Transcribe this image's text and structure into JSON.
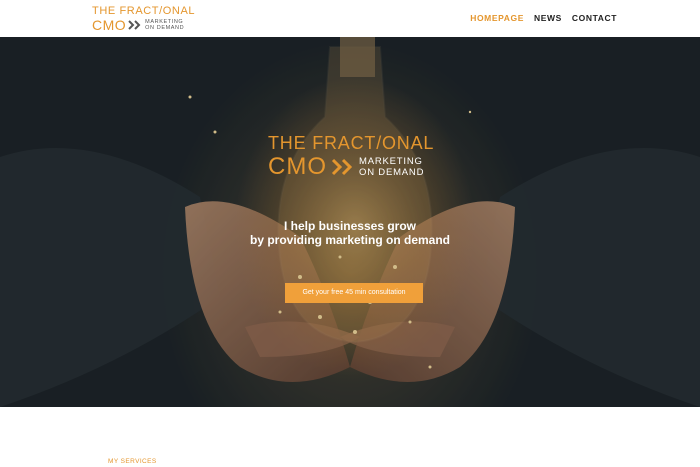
{
  "header": {
    "logo": {
      "line1": "THE FRACT/ONAL",
      "cmo": "CMO",
      "tag_line1": "MARKETING",
      "tag_line2": "ON DEMAND"
    },
    "nav": [
      {
        "label": "HOMEPAGE",
        "active": true
      },
      {
        "label": "NEWS",
        "active": false
      },
      {
        "label": "CONTACT",
        "active": false
      }
    ]
  },
  "hero": {
    "logo": {
      "line1": "THE FRACT/ONAL",
      "cmo": "CMO",
      "tag_line1": "MARKETING",
      "tag_line2": "ON DEMAND"
    },
    "headline_line1": "I help businesses grow",
    "headline_line2": "by providing marketing on demand",
    "cta_label": "Get your free 45 min consultation"
  },
  "services": {
    "label": "MY SERVICES"
  },
  "colors": {
    "accent": "#e4962e",
    "button": "#f0a03a",
    "nav_text": "#222222",
    "hero_text": "#ffffff"
  }
}
